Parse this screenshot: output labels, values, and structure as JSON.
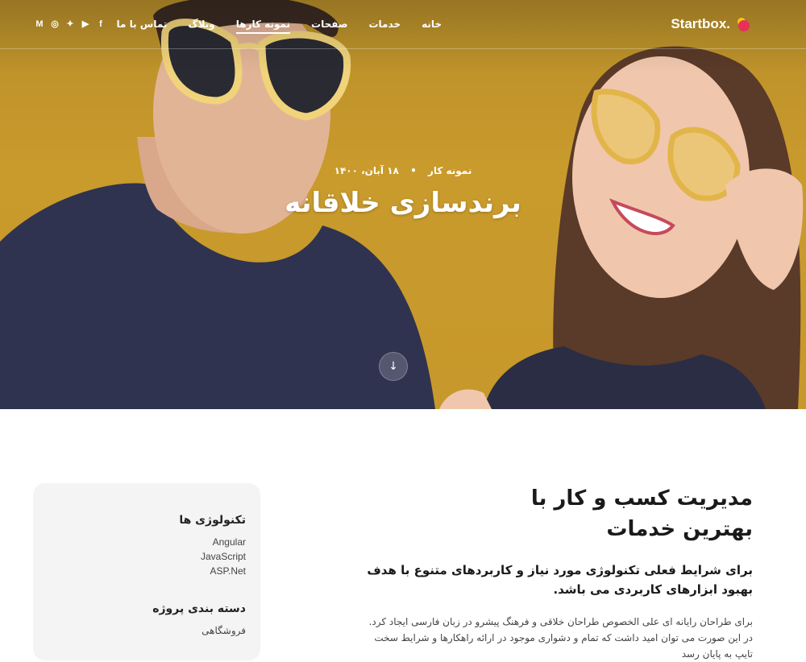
{
  "brand": {
    "name": "Startbox."
  },
  "nav": {
    "items": [
      "خانه",
      "خدمات",
      "صفحات",
      "نمونه کارها",
      "وبلاگ",
      "تماس با ما"
    ],
    "active": "نمونه کارها"
  },
  "social": [
    {
      "icon": "facebook-icon",
      "glyph": "f"
    },
    {
      "icon": "youtube-icon",
      "glyph": "▶"
    },
    {
      "icon": "twitter-icon",
      "glyph": "✦"
    },
    {
      "icon": "instagram-icon",
      "glyph": "◎"
    },
    {
      "icon": "medium-icon",
      "glyph": "M"
    }
  ],
  "hero": {
    "category": "نمونه کار",
    "date": "۱۸ آبان، ۱۴۰۰",
    "title": "برندسازی خلاقانه",
    "scroll_icon": "arrow-down-icon"
  },
  "sidebar": {
    "tech_heading": "تکنولوژی ها",
    "tech_items": [
      "Angular",
      "JavaScript",
      "ASP.Net"
    ],
    "category_heading": "دسته بندی پروژه",
    "category_items": [
      "فروشگاهی"
    ]
  },
  "content": {
    "title_line1": "مدیریت کسب و کار با",
    "title_line2": "بهترین خدمات",
    "lead": "برای شرایط فعلی تکنولوژی مورد نیاز و کاربردهای متنوع با هدف بهبود ابزارهای کاربردی می باشد.",
    "body": "برای طراحان رایانه ای علی الخصوص طراحان خلاقی و فرهنگ پیشرو در زبان فارسی ایجاد کرد. در این صورت می توان امید داشت که تمام و دشواری موجود در ارائه راهکارها و شرایط سخت تایپ به پایان رسد"
  },
  "colors": {
    "hero_bg": "#c7982b",
    "shirt": "#2f3350",
    "logo_dot1": "#f5c518",
    "logo_dot2": "#e8305b"
  }
}
